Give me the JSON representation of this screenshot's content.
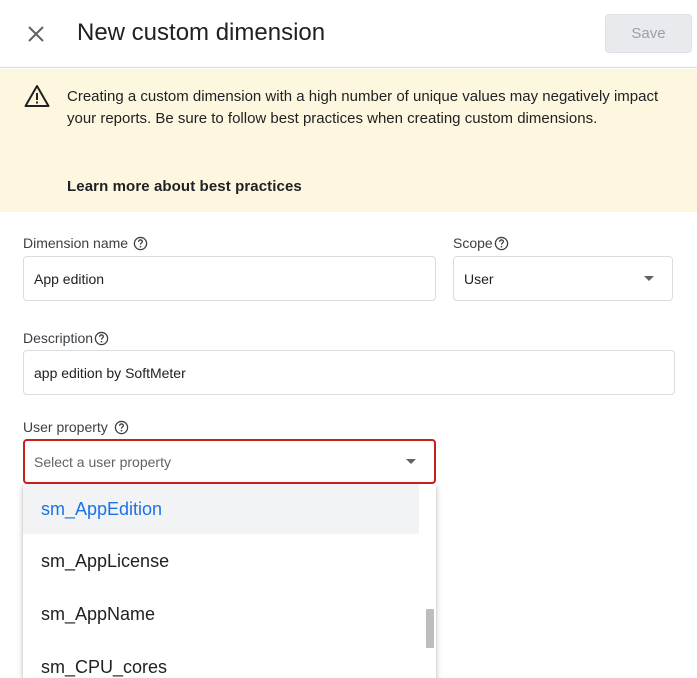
{
  "header": {
    "title": "New custom dimension",
    "save_label": "Save",
    "close_icon": "close-icon"
  },
  "banner": {
    "icon": "warning-icon",
    "text": "Creating a custom dimension with a high number of unique values may negatively impact your reports. Be sure to follow best practices when creating custom dimensions.",
    "link": "Learn more about best practices"
  },
  "form": {
    "dimension_name": {
      "label": "Dimension name",
      "value": "App edition"
    },
    "scope": {
      "label": "Scope",
      "value": "User"
    },
    "description": {
      "label": "Description",
      "value": "app edition by SoftMeter"
    },
    "user_property": {
      "label": "User property",
      "placeholder": "Select a user property"
    }
  },
  "dropdown": {
    "options": [
      "sm_AppEdition",
      "sm_AppLicense",
      "sm_AppName",
      "sm_CPU_cores"
    ],
    "highlighted": "sm_AppEdition"
  },
  "colors": {
    "banner_bg": "#fef7e0",
    "error_border": "#c5221f",
    "selected_text": "#1a73e8"
  }
}
